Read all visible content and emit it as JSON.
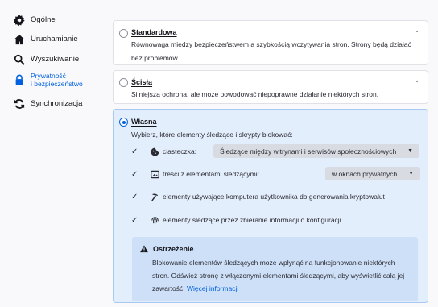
{
  "sidebar": {
    "items": [
      {
        "label": "Ogólne",
        "icon": "gear-icon"
      },
      {
        "label": "Uruchamianie",
        "icon": "home-icon"
      },
      {
        "label": "Wyszukiwanie",
        "icon": "search-icon"
      },
      {
        "label_line1": "Prywatność",
        "label_line2": "i bezpieczeństwo",
        "icon": "lock-icon",
        "selected": true
      },
      {
        "label": "Synchronizacja",
        "icon": "sync-icon"
      }
    ]
  },
  "protection": {
    "standard": {
      "title": "Standardowa",
      "description": "Równowaga między bezpieczeństwem a szybkością wczytywania stron. Strony będą działać bez problemów."
    },
    "strict": {
      "title": "Ścisła",
      "description": "Silniejsza ochrona, ale może powodować niepoprawne działanie niektórych stron."
    },
    "custom": {
      "title": "Własna",
      "intro": "Wybierz, które elementy śledzące i skrypty blokować:",
      "options": {
        "cookies": {
          "label": "ciasteczka:",
          "select_value": "Śledzące między witrynami i serwisów społecznościowych",
          "checked": true
        },
        "tracking_content": {
          "label": "treści z elementami śledzącymi:",
          "select_value": "w oknach prywatnych",
          "checked": true
        },
        "cryptominers": {
          "label": "elementy używające komputera użytkownika do generowania kryptowalut",
          "checked": true
        },
        "fingerprinters": {
          "label": "elementy śledzące przez zbieranie informacji o konfiguracji",
          "checked": true
        }
      },
      "warning": {
        "title": "Ostrzeżenie",
        "text": "Blokowanie elementów śledzących może wpłynąć na funkcjonowanie niektórych stron. Odśwież stronę z włączonymi elementami śledzącymi, aby wyświetlić całą jej zawartość.",
        "link": "Więcej informacji"
      }
    }
  },
  "colors": {
    "accent": "#0061e0",
    "active_card": "#e3eefc",
    "warning_bg": "#cde0f7"
  }
}
